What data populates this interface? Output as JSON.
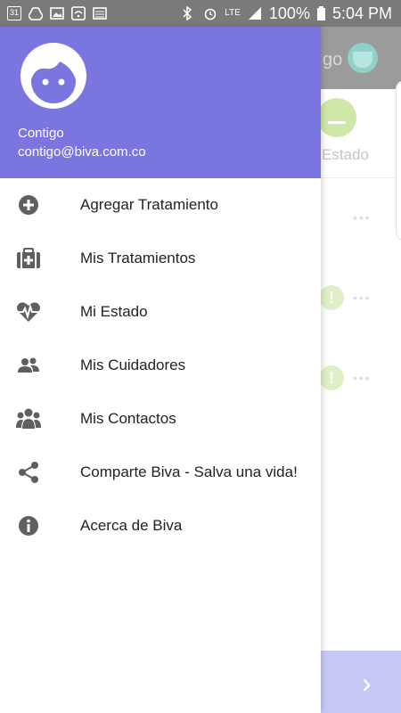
{
  "status_bar": {
    "left_icons": [
      "calendar-icon",
      "drive-icon",
      "image-icon",
      "wifi-icon",
      "keyboard-icon"
    ],
    "calendar_day": "31",
    "network": "LTE",
    "battery": "100%",
    "time": "5:04 PM"
  },
  "background": {
    "title_fragment": "go",
    "status_label": "Estado"
  },
  "drawer": {
    "user_name": "Contigo",
    "user_email": "contigo@biva.com.co",
    "items": [
      {
        "label": "Agregar Tratamiento",
        "icon": "plus-circle-icon"
      },
      {
        "label": "Mis Tratamientos",
        "icon": "medical-kit-icon"
      },
      {
        "label": "Mi Estado",
        "icon": "heartbeat-icon"
      },
      {
        "label": "Mis Cuidadores",
        "icon": "caregivers-icon"
      },
      {
        "label": "Mis Contactos",
        "icon": "contacts-icon"
      },
      {
        "label": "Comparte Biva - Salva una vida!",
        "icon": "share-icon"
      },
      {
        "label": "Acerca de Biva",
        "icon": "info-icon"
      }
    ]
  },
  "colors": {
    "header": "#7b76df",
    "icons": "#5f5f5f",
    "status_bar": "#7a7a7a"
  }
}
